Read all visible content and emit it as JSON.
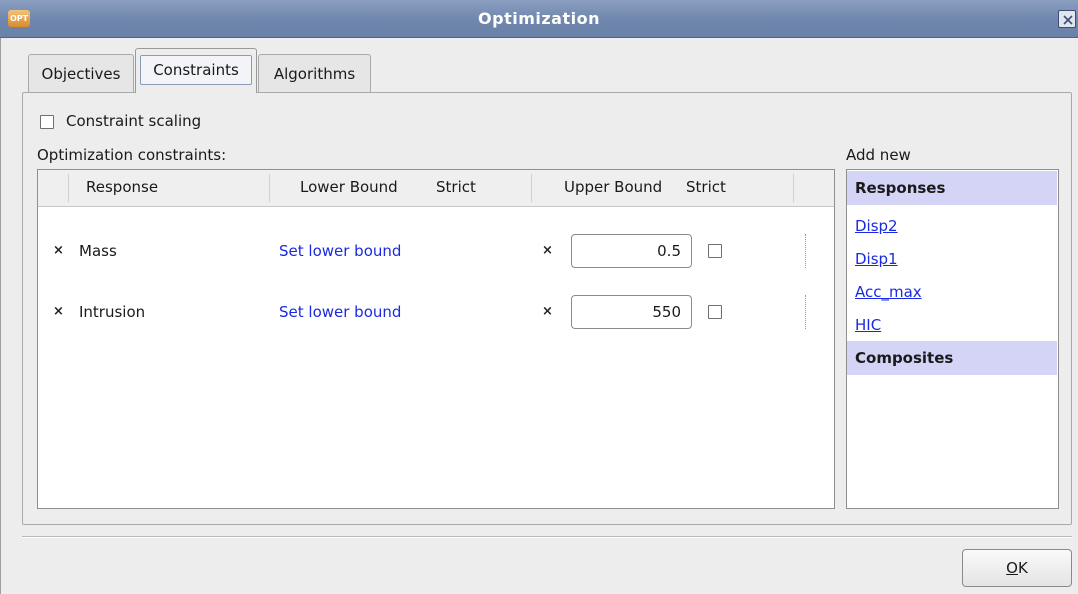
{
  "window": {
    "title": "Optimization",
    "app_icon_text": "OPT"
  },
  "tabs": [
    {
      "label": "Objectives",
      "active": false
    },
    {
      "label": "Constraints",
      "active": true
    },
    {
      "label": "Algorithms",
      "active": false
    }
  ],
  "constraint_scaling": {
    "label": "Constraint scaling",
    "checked": false
  },
  "constraints_section": {
    "label": "Optimization constraints:"
  },
  "table": {
    "columns": [
      "Response",
      "Lower Bound",
      "Strict",
      "Upper Bound",
      "Strict"
    ],
    "rows": [
      {
        "response": "Mass",
        "lower_bound_link": "Set lower bound",
        "upper_bound": "0.5",
        "upper_strict": false
      },
      {
        "response": "Intrusion",
        "lower_bound_link": "Set lower bound",
        "upper_bound": "550",
        "upper_strict": false
      }
    ],
    "remove_glyph": "×"
  },
  "add_new": {
    "label": "Add new",
    "responses_header": "Responses",
    "responses": [
      "Disp2",
      "Disp1",
      "Acc_max",
      "HIC"
    ],
    "composites_header": "Composites"
  },
  "footer": {
    "ok_label": "OK",
    "ok_mnemonic": "O",
    "ok_rest": "K"
  },
  "colors": {
    "titlebar": "#7088ae",
    "link": "#1a2ae0",
    "side_header": "#d4d4f7"
  }
}
